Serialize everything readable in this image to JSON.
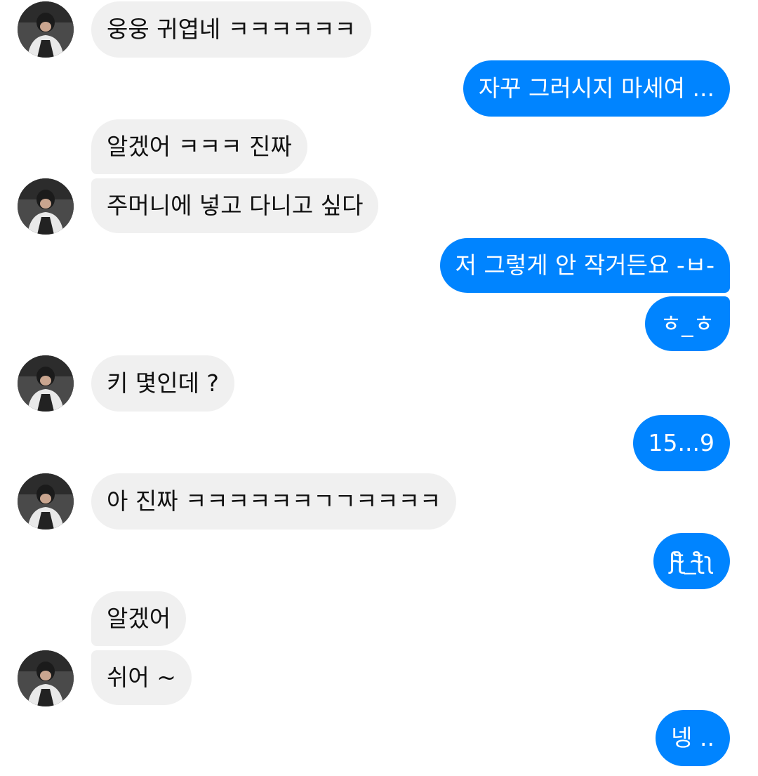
{
  "colors": {
    "incoming_bg": "#f0f0f0",
    "outgoing_bg": "#0084ff",
    "outgoing_text": "#ffffff",
    "incoming_text": "#111111"
  },
  "contact": {
    "avatar_icon": "avatar-photo-icon"
  },
  "messages": [
    {
      "from": "them",
      "text": "웅웅 귀엽네 ㅋㅋㅋㅋㅋㅋ"
    },
    {
      "from": "me",
      "text": "자꾸 그러시지 마세여 ..."
    },
    {
      "from": "them",
      "text": "알겠어 ㅋㅋㅋ 진짜"
    },
    {
      "from": "them",
      "text": "주머니에 넣고 다니고 싶다"
    },
    {
      "from": "me",
      "text": "저 그렇게 안 작거든요 -ㅂ-"
    },
    {
      "from": "me",
      "text": "ㅎ_ㅎ"
    },
    {
      "from": "them",
      "text": "키 몇인데 ?"
    },
    {
      "from": "me",
      "text": "15...9"
    },
    {
      "from": "them",
      "text": "아 진짜 ㅋㅋㅋㅋㅋㅋㄱㄱㅋㅋㅋㅋ"
    },
    {
      "from": "me",
      "text": "ʃƪ̴_ƪ̴ʅ"
    },
    {
      "from": "them",
      "text": "알겠어"
    },
    {
      "from": "them",
      "text": "쉬어 ~"
    },
    {
      "from": "me",
      "text": "넹 .."
    }
  ]
}
